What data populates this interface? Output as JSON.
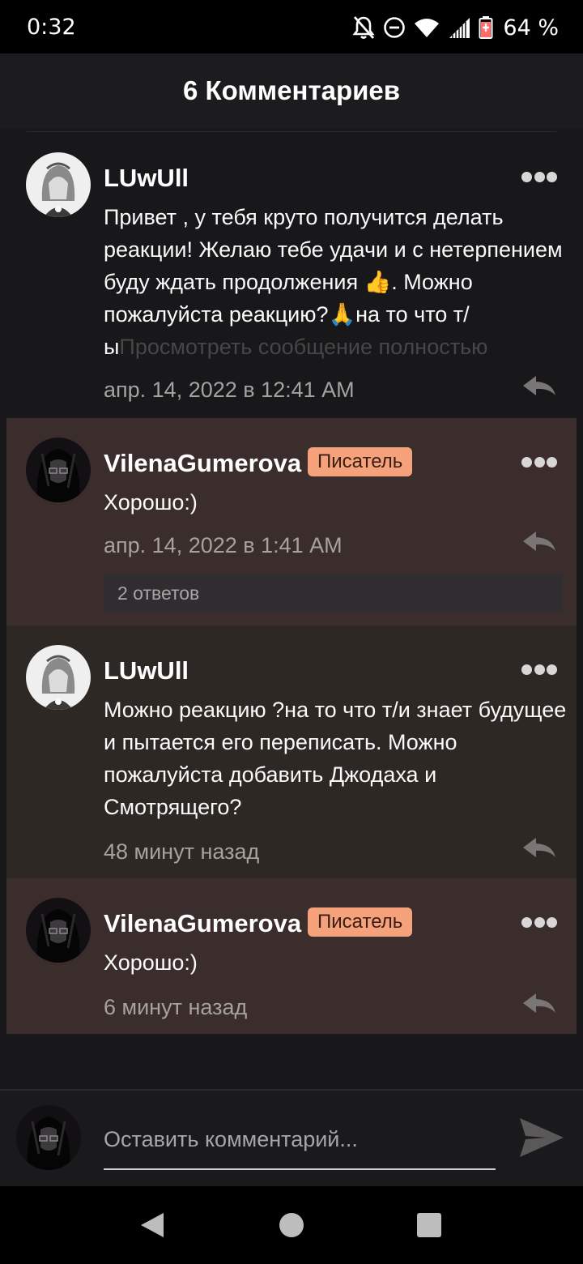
{
  "status_bar": {
    "time": "0:32",
    "battery": "64 %"
  },
  "header": {
    "title": "6 Комментариев"
  },
  "comments": [
    {
      "username": "LUwUll",
      "text": "Привет , у тебя круто получится делать реакции! Желаю тебе удачи и с нетерпением буду ждать продолжения 👍. Можно пожалуйста реакцию?🙏на то что т/ы",
      "see_more": "Просмотреть сообщение полностью",
      "time": "апр. 14, 2022 в 12:41 AM"
    },
    {
      "username": "VilenaGumerova",
      "badge": "Писатель",
      "text": "Хорошо:)",
      "time": "апр. 14, 2022 в 1:41 AM",
      "replies": "2 ответов"
    },
    {
      "username": "LUwUll",
      "text": "Можно реакцию ?на то что т/и знает будущее и пытается его переписать. Можно пожалуйста добавить Джодаха и Смотрящего?",
      "time": "48 минут назад"
    },
    {
      "username": "VilenaGumerova",
      "badge": "Писатель",
      "text": "Хорошо:)",
      "time": "6 минут назад"
    }
  ],
  "composer": {
    "placeholder": "Оставить комментарий..."
  },
  "colors": {
    "badge": "#f5a27c",
    "writer_bg": "#3a2d2b",
    "reader_bg": "#2e2824",
    "app_bg": "#18171a"
  },
  "icons": [
    "notifications-off-icon",
    "do-not-disturb-icon",
    "wifi-icon",
    "signal-icon",
    "battery-icon",
    "more-icon",
    "reply-icon",
    "send-icon",
    "back-icon",
    "home-icon",
    "recents-icon"
  ]
}
